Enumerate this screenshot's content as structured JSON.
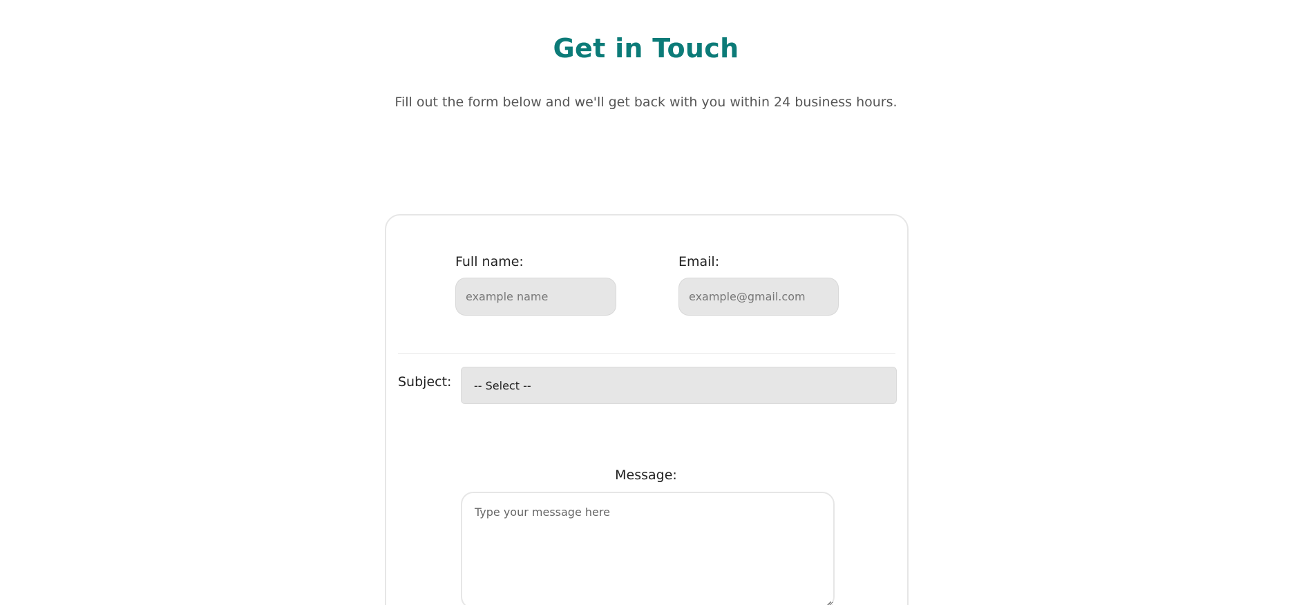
{
  "header": {
    "title": "Get in Touch",
    "subtitle": "Fill out the form below and we'll get back with you within 24 business hours."
  },
  "form": {
    "full_name": {
      "label": "Full name:",
      "placeholder": "example name",
      "value": ""
    },
    "email": {
      "label": "Email:",
      "placeholder": "example@gmail.com",
      "value": ""
    },
    "subject": {
      "label": "Subject:",
      "selected": "-- Select --"
    },
    "message": {
      "label": "Message:",
      "placeholder": "Type your message here",
      "value": ""
    }
  },
  "colors": {
    "accent": "#0c7b78",
    "input_background": "#e6e6e6",
    "card_border": "#e6e6e6"
  },
  "icons": {
    "textarea_resize": "resize-handle-icon"
  }
}
